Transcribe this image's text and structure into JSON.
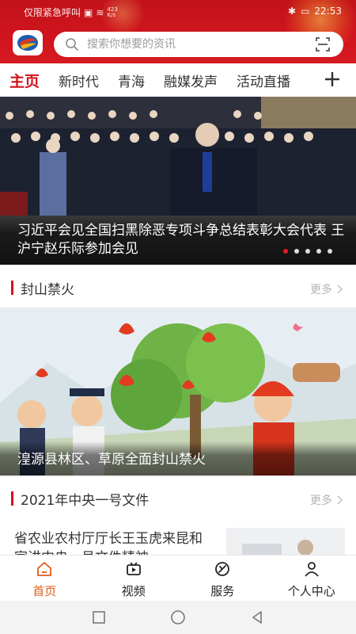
{
  "status_bar": {
    "left_text": "仅限紧急呼叫",
    "speed_top": "423",
    "speed_bottom": "K/s",
    "time": "22:53"
  },
  "header": {
    "search_placeholder": "搜索你想要的资讯"
  },
  "tabs": [
    {
      "label": "主页",
      "active": true
    },
    {
      "label": "新时代",
      "active": false
    },
    {
      "label": "青海",
      "active": false
    },
    {
      "label": "融媒发声",
      "active": false
    },
    {
      "label": "活动直播",
      "active": false
    }
  ],
  "hero": {
    "caption": "习近平会见全国扫黑除恶专项斗争总结表彰大会代表 王沪宁赵乐际参加会见",
    "dots_count": 5,
    "active_dot": 0
  },
  "sections": [
    {
      "title": "封山禁火",
      "more": "更多"
    },
    {
      "title": "2021年中央一号文件",
      "more": "更多"
    }
  ],
  "feature": {
    "caption": "湟源县林区、草原全面封山禁火"
  },
  "article": {
    "title": "省农业农村厅厅长王玉虎来昆和宣讲中央一号文件精神"
  },
  "bottom_nav": [
    {
      "label": "首页",
      "icon": "home-icon",
      "active": true
    },
    {
      "label": "视频",
      "icon": "video-icon",
      "active": false
    },
    {
      "label": "服务",
      "icon": "service-icon",
      "active": false
    },
    {
      "label": "个人中心",
      "icon": "user-icon",
      "active": false
    }
  ],
  "colors": {
    "brand_red": "#d0121b",
    "nav_active": "#e05a1a"
  }
}
